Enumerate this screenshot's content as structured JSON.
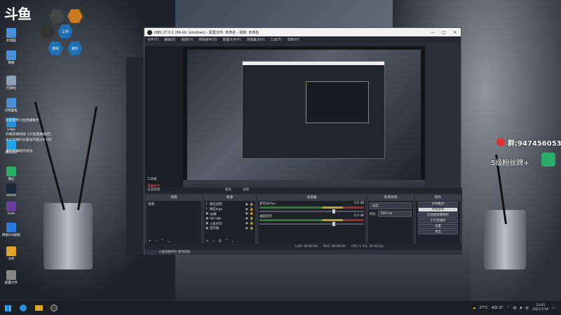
{
  "desktop": {
    "logo_text": "斗鱼",
    "hex_menu": [
      {
        "label": "工作",
        "color": "#1f6fb5"
      },
      {
        "label": "游戏",
        "color": "#1f6fb5"
      },
      {
        "label": "娱乐",
        "color": "#1f6fb5"
      }
    ],
    "icons": [
      {
        "label": "此电脑",
        "color": "#4a90d9"
      },
      {
        "label": "网络",
        "color": "#4a90d9"
      },
      {
        "label": "回收站",
        "color": "#8fa0b5"
      },
      {
        "label": "控制面板",
        "color": "#4a90d9"
      },
      {
        "label": "Edge",
        "color": "#2b8fd6"
      },
      {
        "label": "腾讯QQ",
        "color": "#1fa1e6"
      },
      {
        "label": "微信",
        "color": "#2aae67"
      },
      {
        "label": "Steam",
        "color": "#1b2838"
      },
      {
        "label": "GOG",
        "color": "#6b3fa0"
      },
      {
        "label": "网易UU加速器",
        "color": "#2b7ad9"
      },
      {
        "label": "文件",
        "color": "#e0a22b"
      },
      {
        "label": "配置文件",
        "color": "#888888"
      }
    ],
    "notifications": [
      "欢迎使用斗鱼直播助手",
      "开播前请阅读《斗鱼直播规范》",
      "本次开播时长建议不超过4小时",
      "添加弹幕助手成功"
    ],
    "overlay": {
      "qq_text": "群:947456053",
      "fans_text": "5级粉丝牌+"
    }
  },
  "obs": {
    "title": "OBS 27.0.1 (64-bit, windows) - 配置文件: 未命名 - 场景: 未命名",
    "window_buttons": [
      "—",
      "□",
      "✕"
    ],
    "menu": [
      "文件(F)",
      "编辑(E)",
      "视图(V)",
      "停靠部件(D)",
      "配置文件(P)",
      "场景集合(S)",
      "工具(T)",
      "帮助(H)"
    ],
    "tools": [
      "工具箱",
      "弹幕助手"
    ],
    "status_line": "未选择源",
    "top_tabs": [
      "属性",
      "滤镜"
    ],
    "scenes": {
      "header": "场景",
      "items": [
        "场景"
      ]
    },
    "sources": {
      "header": "来源",
      "items": [
        {
          "icon": "T",
          "name": "微信说明"
        },
        {
          "icon": "T",
          "name": "微信logo"
        },
        {
          "icon": "▣",
          "name": "qq群"
        },
        {
          "icon": "▣",
          "name": "qql.ogo"
        },
        {
          "icon": "▣",
          "name": "斗鱼水印"
        },
        {
          "icon": "▣",
          "name": "显示器"
        }
      ]
    },
    "mixer": {
      "header": "混音器",
      "channels": [
        {
          "name": "麦克风/Aux",
          "db": "0.0 dB"
        },
        {
          "name": "桌面音频",
          "db": "0.0 dB"
        }
      ]
    },
    "transitions": {
      "header": "场景转场",
      "type": "淡出",
      "duration_label": "时长",
      "duration": "300 ms"
    },
    "controls": {
      "header": "控件",
      "buttons": [
        "开始推流",
        "开始录制",
        "启动虚拟摄像机",
        "工作室模式",
        "设置",
        "退出"
      ]
    },
    "status": {
      "live": "LIVE: 00:00:00",
      "rec": "REC: 00:00:00",
      "cpu": "CPU: 1.3%, 30.00 fps"
    },
    "notice": "斗鱼直播伴侣 使用帮助"
  },
  "taskbar": {
    "weather": "27°C",
    "aqi": "AQI 37",
    "ime": "中",
    "time": "23:05",
    "date": "2021/7/19"
  }
}
